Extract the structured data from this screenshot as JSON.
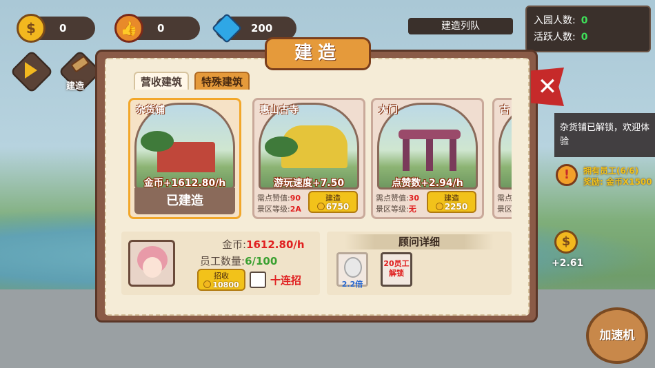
{
  "resources": {
    "coins": "0",
    "likes": "0",
    "gems": "200"
  },
  "stats": {
    "visitors_label": "入园人数:",
    "visitors_value": "0",
    "active_label": "活跃人数:",
    "active_value": "0"
  },
  "queue_title": "建造列队",
  "side": {
    "build_label": "建造"
  },
  "modal": {
    "title": "建造",
    "tabs": [
      "营收建筑",
      "特殊建筑"
    ],
    "cards": [
      {
        "name": "杂货铺",
        "yield": "金币+1612.80/h",
        "status": "已建造"
      },
      {
        "name": "惠山古寺",
        "yield": "游玩速度+7.50",
        "req_likes_label": "需点赞值:",
        "req_likes": "90",
        "req_level_label": "景区等级:",
        "req_level": "2A",
        "button_label": "建造",
        "cost": "6750"
      },
      {
        "name": "大门",
        "yield": "点赞数+2.94/h",
        "req_likes_label": "需点赞值:",
        "req_likes": "30",
        "req_level_label": "景区等级:",
        "req_level": "无",
        "button_label": "建造",
        "cost": "2250"
      },
      {
        "name": "古",
        "req_likes_label": "需点",
        "req_level_label": "景区"
      }
    ],
    "info": {
      "coin_label": "金币:",
      "coin_value": "1612.80/h",
      "staff_label": "员工数量:",
      "staff_value": "6/100",
      "hire_label": "招收",
      "hire_cost": "10800",
      "ten_label": "十连招"
    },
    "advisor": {
      "title": "顾问详细",
      "advisor1_label": "2.2倍",
      "advisor2_label": "20员工解锁"
    }
  },
  "notice": "杂货铺已解锁，欢迎体验",
  "task": {
    "title": "拥有员工(6/6)",
    "reward": "奖励: 金币X1500"
  },
  "float_coin": "+2.61",
  "speedup_label": "加速机"
}
